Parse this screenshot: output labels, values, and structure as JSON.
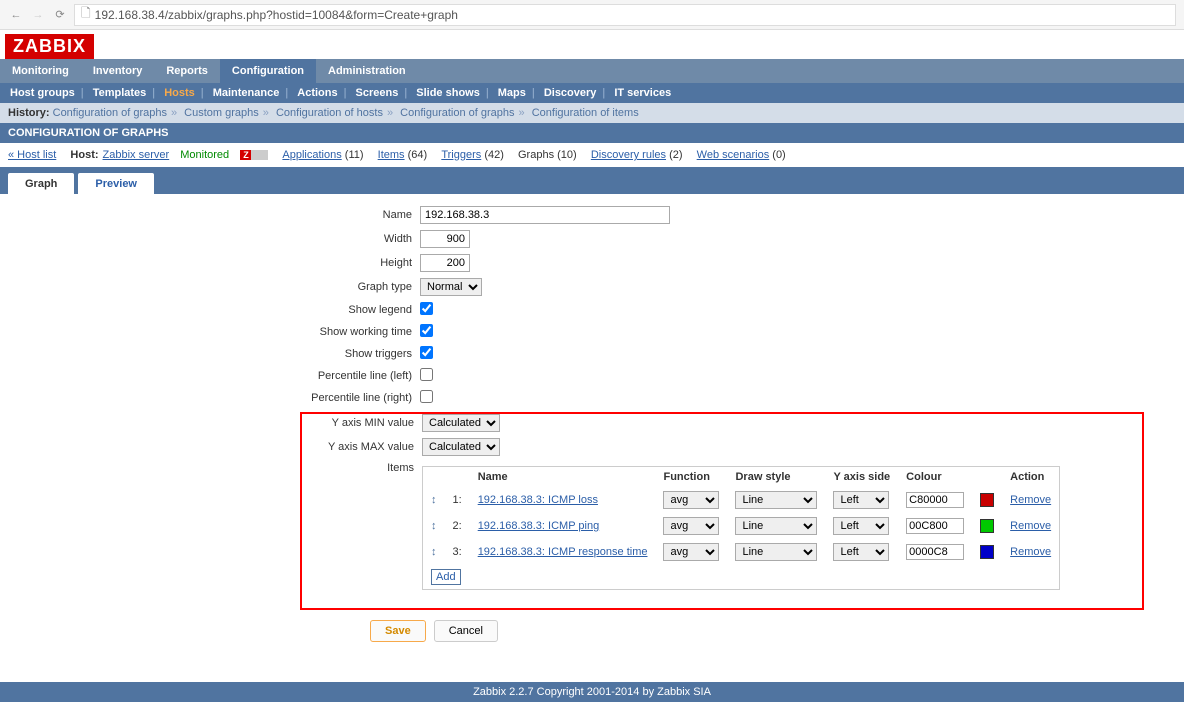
{
  "browser": {
    "url": "192.168.38.4/zabbix/graphs.php?hostid=10084&form=Create+graph"
  },
  "logo": "ZABBIX",
  "main_nav": [
    "Monitoring",
    "Inventory",
    "Reports",
    "Configuration",
    "Administration"
  ],
  "main_nav_active": "Configuration",
  "sub_nav": [
    "Host groups",
    "Templates",
    "Hosts",
    "Maintenance",
    "Actions",
    "Screens",
    "Slide shows",
    "Maps",
    "Discovery",
    "IT services"
  ],
  "sub_nav_active": "Hosts",
  "history": {
    "label": "History:",
    "items": [
      "Configuration of graphs",
      "Custom graphs",
      "Configuration of hosts",
      "Configuration of graphs",
      "Configuration of items"
    ]
  },
  "page_title": "CONFIGURATION OF GRAPHS",
  "context": {
    "back": "« Host list",
    "host_label": "Host:",
    "host_name": "Zabbix server",
    "status": "Monitored",
    "links": [
      {
        "label": "Applications",
        "count": "(11)"
      },
      {
        "label": "Items",
        "count": "(64)"
      },
      {
        "label": "Triggers",
        "count": "(42)"
      },
      {
        "label": "Graphs",
        "count": "(10)",
        "current": true
      },
      {
        "label": "Discovery rules",
        "count": "(2)"
      },
      {
        "label": "Web scenarios",
        "count": "(0)"
      }
    ]
  },
  "tabs": [
    "Graph",
    "Preview"
  ],
  "tab_active": "Graph",
  "form": {
    "name_label": "Name",
    "name_value": "192.168.38.3",
    "width_label": "Width",
    "width_value": "900",
    "height_label": "Height",
    "height_value": "200",
    "graphtype_label": "Graph type",
    "graphtype_value": "Normal",
    "legend_label": "Show legend",
    "workingtime_label": "Show working time",
    "triggers_label": "Show triggers",
    "pleft_label": "Percentile line (left)",
    "pright_label": "Percentile line (right)",
    "ymin_label": "Y axis MIN value",
    "ymin_value": "Calculated",
    "ymax_label": "Y axis MAX value",
    "ymax_value": "Calculated",
    "items_label": "Items"
  },
  "items_table": {
    "headers": {
      "name": "Name",
      "function": "Function",
      "drawstyle": "Draw style",
      "yside": "Y axis side",
      "colour": "Colour",
      "action": "Action"
    },
    "rows": [
      {
        "idx": "1:",
        "name": "192.168.38.3: ICMP loss",
        "func": "avg",
        "draw": "Line",
        "side": "Left",
        "color": "C80000",
        "swatch": "#C80000",
        "action": "Remove"
      },
      {
        "idx": "2:",
        "name": "192.168.38.3: ICMP ping",
        "func": "avg",
        "draw": "Line",
        "side": "Left",
        "color": "00C800",
        "swatch": "#00C800",
        "action": "Remove"
      },
      {
        "idx": "3:",
        "name": "192.168.38.3: ICMP response time",
        "func": "avg",
        "draw": "Line",
        "side": "Left",
        "color": "0000C8",
        "swatch": "#0000C8",
        "action": "Remove"
      }
    ],
    "add": "Add"
  },
  "buttons": {
    "save": "Save",
    "cancel": "Cancel"
  },
  "footer": "Zabbix 2.2.7 Copyright 2001-2014 by Zabbix SIA"
}
